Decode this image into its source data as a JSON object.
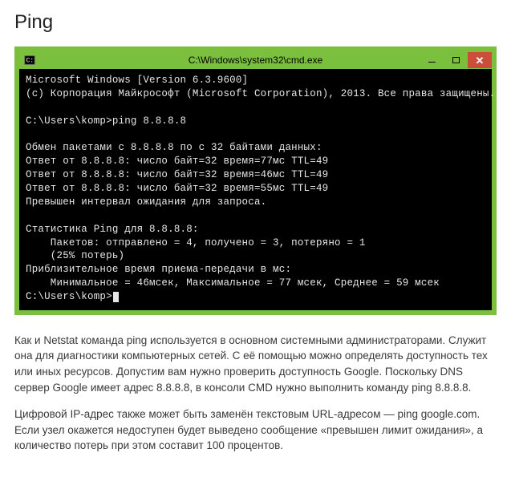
{
  "heading": "Ping",
  "window": {
    "title": "C:\\Windows\\system32\\cmd.exe"
  },
  "console": {
    "lines": [
      "Microsoft Windows [Version 6.3.9600]",
      "(c) Корпорация Майкрософт (Microsoft Corporation), 2013. Все права защищены.",
      "",
      "C:\\Users\\komp>ping 8.8.8.8",
      "",
      "Обмен пакетами с 8.8.8.8 по с 32 байтами данных:",
      "Ответ от 8.8.8.8: число байт=32 время=77мс TTL=49",
      "Ответ от 8.8.8.8: число байт=32 время=46мс TTL=49",
      "Ответ от 8.8.8.8: число байт=32 время=55мс TTL=49",
      "Превышен интервал ожидания для запроса.",
      "",
      "Статистика Ping для 8.8.8.8:",
      "    Пакетов: отправлено = 4, получено = 3, потеряно = 1",
      "    (25% потерь)",
      "Приблизительное время приема-передачи в мс:",
      "    Минимальное = 46мсек, Максимальное = 77 мсек, Среднее = 59 мсек",
      ""
    ],
    "prompt": "C:\\Users\\komp>"
  },
  "paragraphs": [
    "Как и Netstat команда ping используется в основном системными администраторами. Служит она для диагностики компьютерных сетей. С её помощью можно определять доступность тех или иных ресурсов. Допустим вам нужно проверить доступность Google. Поскольку DNS сервер Google имеет адрес 8.8.8.8, в консоли CMD нужно выполнить команду ping 8.8.8.8.",
    "Цифровой IP-адрес также может быть заменён текстовым URL-адресом — ping google.com. Если узел окажется недоступен будет выведено сообщение «превышен лимит ожидания», а количество потерь при этом составит 100 процентов."
  ]
}
